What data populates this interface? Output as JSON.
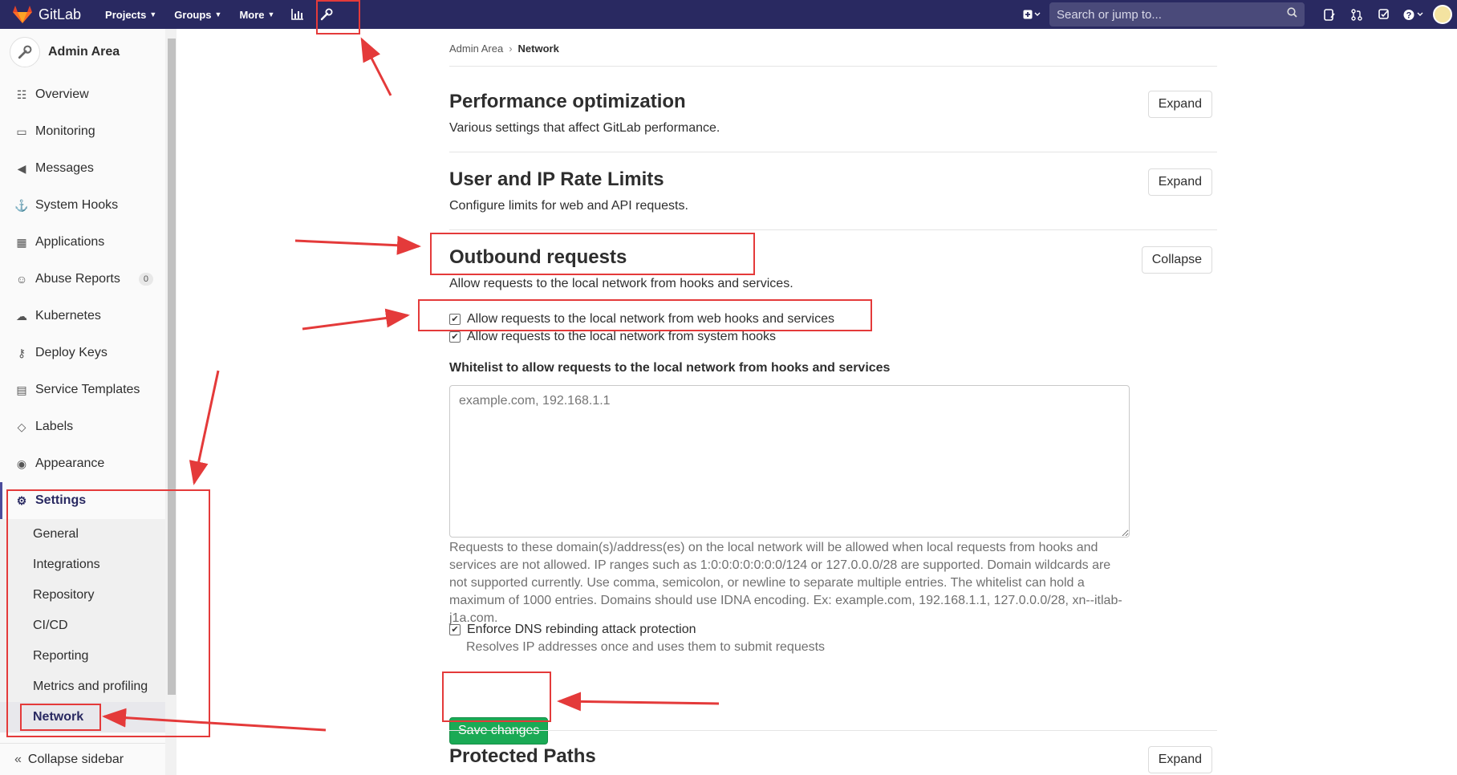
{
  "topbar": {
    "brand": "GitLab",
    "nav": [
      {
        "label": "Projects"
      },
      {
        "label": "Groups"
      },
      {
        "label": "More"
      }
    ],
    "search_placeholder": "Search or jump to..."
  },
  "sidebar": {
    "title": "Admin Area",
    "items": [
      {
        "label": "Overview",
        "icon": "overview-icon"
      },
      {
        "label": "Monitoring",
        "icon": "monitor-icon"
      },
      {
        "label": "Messages",
        "icon": "megaphone-icon"
      },
      {
        "label": "System Hooks",
        "icon": "hook-icon"
      },
      {
        "label": "Applications",
        "icon": "applications-icon"
      },
      {
        "label": "Abuse Reports",
        "icon": "smiley-icon",
        "badge": "0"
      },
      {
        "label": "Kubernetes",
        "icon": "cloud-icon"
      },
      {
        "label": "Deploy Keys",
        "icon": "key-icon"
      },
      {
        "label": "Service Templates",
        "icon": "template-icon"
      },
      {
        "label": "Labels",
        "icon": "label-icon"
      },
      {
        "label": "Appearance",
        "icon": "palette-icon"
      },
      {
        "label": "Settings",
        "icon": "gear-icon"
      }
    ],
    "settings_sub": [
      {
        "label": "General"
      },
      {
        "label": "Integrations"
      },
      {
        "label": "Repository"
      },
      {
        "label": "CI/CD"
      },
      {
        "label": "Reporting"
      },
      {
        "label": "Metrics and profiling"
      },
      {
        "label": "Network"
      }
    ],
    "collapse_label": "Collapse sidebar"
  },
  "breadcrumb": {
    "parent": "Admin Area",
    "current": "Network"
  },
  "sections": {
    "perf": {
      "title": "Performance optimization",
      "desc": "Various settings that affect GitLab performance.",
      "button": "Expand"
    },
    "rate": {
      "title": "User and IP Rate Limits",
      "desc": "Configure limits for web and API requests.",
      "button": "Expand"
    },
    "outbound": {
      "title": "Outbound requests",
      "desc": "Allow requests to the local network from hooks and services.",
      "button": "Collapse",
      "check_web": "Allow requests to the local network from web hooks and services",
      "check_system": "Allow requests to the local network from system hooks",
      "whitelist_label": "Whitelist to allow requests to the local network from hooks and services",
      "whitelist_placeholder": "example.com, 192.168.1.1",
      "help": "Requests to these domain(s)/address(es) on the local network will be allowed when local requests from hooks and services are not allowed. IP ranges such as 1:0:0:0:0:0:0:0/124 or 127.0.0.0/28 are supported. Domain wildcards are not supported currently. Use comma, semicolon, or newline to separate multiple entries. The whitelist can hold a maximum of 1000 entries. Domains should use IDNA encoding. Ex: example.com, 192.168.1.1, 127.0.0.0/28, xn--itlab-j1a.com.",
      "dns_label": "Enforce DNS rebinding attack protection",
      "dns_help": "Resolves IP addresses once and uses them to submit requests",
      "save": "Save changes"
    },
    "protected": {
      "title": "Protected Paths",
      "button": "Expand"
    }
  },
  "colors": {
    "nav": "#292961",
    "save": "#1aaa55",
    "annotation": "#e43a3a"
  }
}
